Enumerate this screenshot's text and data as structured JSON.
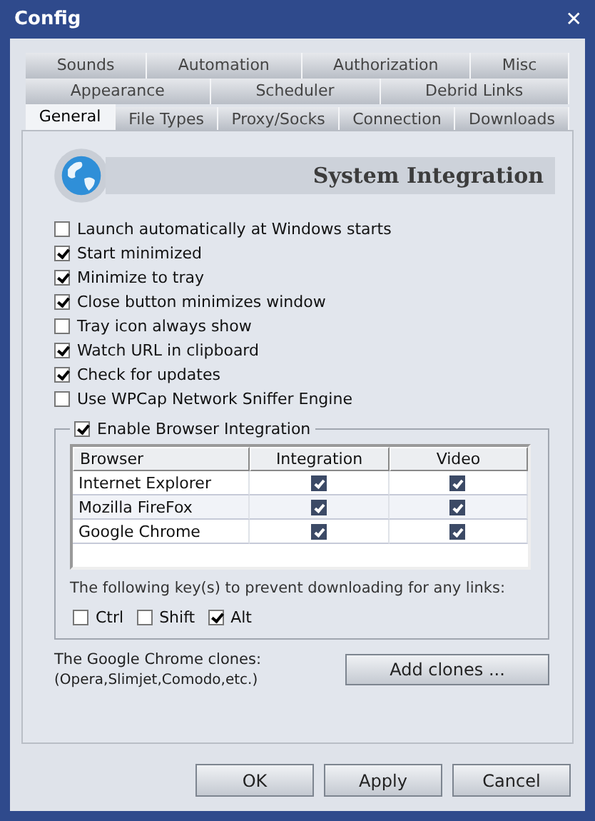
{
  "window": {
    "title": "Config",
    "close": "✕"
  },
  "tab_rows": [
    [
      {
        "label": "Sounds",
        "selected": false
      },
      {
        "label": "Automation",
        "selected": false
      },
      {
        "label": "Authorization",
        "selected": false
      },
      {
        "label": "Misc",
        "selected": false
      }
    ],
    [
      {
        "label": "Appearance",
        "selected": false
      },
      {
        "label": "Scheduler",
        "selected": false
      },
      {
        "label": "Debrid Links",
        "selected": false
      }
    ],
    [
      {
        "label": "General",
        "selected": true
      },
      {
        "label": "File Types",
        "selected": false
      },
      {
        "label": "Proxy/Socks",
        "selected": false
      },
      {
        "label": "Connection",
        "selected": false
      },
      {
        "label": "Downloads",
        "selected": false
      }
    ]
  ],
  "section": {
    "title": "System Integration"
  },
  "options": [
    {
      "label": "Launch automatically at Windows starts",
      "checked": false
    },
    {
      "label": "Start minimized",
      "checked": true
    },
    {
      "label": "Minimize to tray",
      "checked": true
    },
    {
      "label": "Close button minimizes window",
      "checked": true
    },
    {
      "label": "Tray icon always show",
      "checked": false
    },
    {
      "label": "Watch URL in clipboard",
      "checked": true
    },
    {
      "label": "Check for updates",
      "checked": true
    },
    {
      "label": "Use WPCap Network Sniffer Engine",
      "checked": false
    }
  ],
  "browser_integration": {
    "label": "Enable Browser Integration",
    "checked": true,
    "columns": [
      "Browser",
      "Integration",
      "Video"
    ],
    "rows": [
      {
        "browser": "Internet Explorer",
        "integration": true,
        "video": true
      },
      {
        "browser": "Mozilla FireFox",
        "integration": true,
        "video": true
      },
      {
        "browser": "Google Chrome",
        "integration": true,
        "video": true
      }
    ],
    "keys_label": "The following key(s) to prevent downloading for any links:",
    "keys": [
      {
        "label": "Ctrl",
        "checked": false
      },
      {
        "label": "Shift",
        "checked": false
      },
      {
        "label": "Alt",
        "checked": true
      }
    ]
  },
  "clones": {
    "label": "The Google Chrome clones:",
    "note": "(Opera,Slimjet,Comodo,etc.)",
    "button": "Add clones ..."
  },
  "buttons": [
    "OK",
    "Apply",
    "Cancel"
  ]
}
